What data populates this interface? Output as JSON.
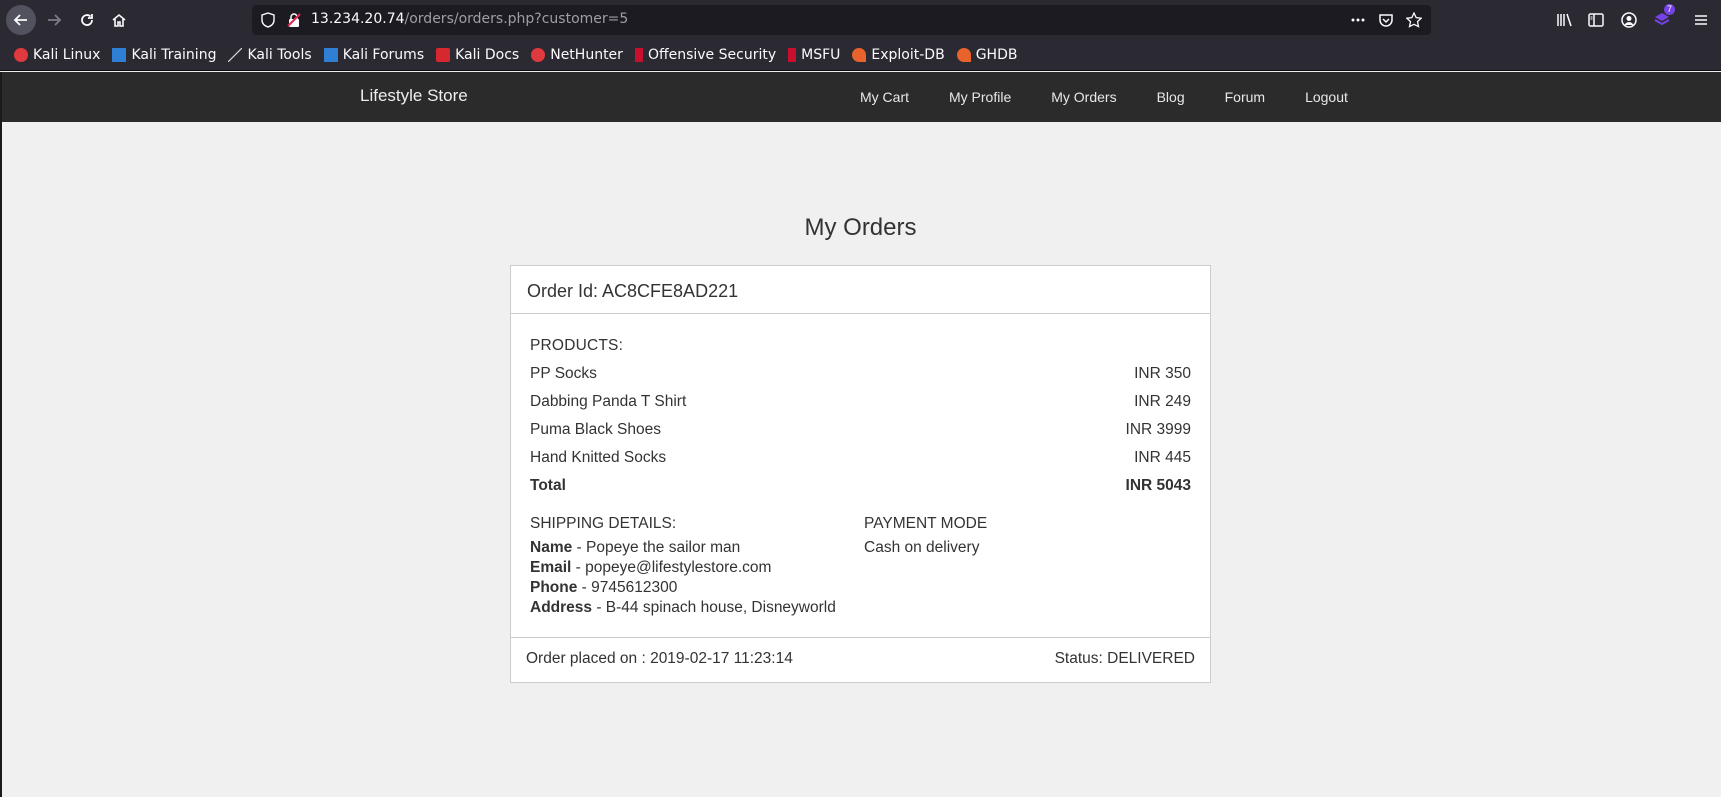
{
  "browser": {
    "url_host": "13.234.20.74",
    "url_path": "/orders/orders.php?customer=5",
    "extension_badge": "7",
    "bookmarks": [
      {
        "label": "Kali Linux",
        "icon": "kali-dragon-icon",
        "color": "#e0393e"
      },
      {
        "label": "Kali Training",
        "icon": "kali-training-icon",
        "color": "#2f7fd4"
      },
      {
        "label": "Kali Tools",
        "icon": "kali-tools-icon",
        "color": "#111111"
      },
      {
        "label": "Kali Forums",
        "icon": "kali-forums-icon",
        "color": "#2f7fd4"
      },
      {
        "label": "Kali Docs",
        "icon": "kali-docs-icon",
        "color": "#d7282f"
      },
      {
        "label": "NetHunter",
        "icon": "nethunter-icon",
        "color": "#e0393e"
      },
      {
        "label": "Offensive Security",
        "icon": "offsec-icon",
        "color": "#c8102e"
      },
      {
        "label": "MSFU",
        "icon": "msfu-icon",
        "color": "#c8102e"
      },
      {
        "label": "Exploit-DB",
        "icon": "exploitdb-icon",
        "color": "#e8632b"
      },
      {
        "label": "GHDB",
        "icon": "ghdb-icon",
        "color": "#e8632b"
      }
    ]
  },
  "site": {
    "brand": "Lifestyle Store",
    "nav": [
      "My Cart",
      "My Profile",
      "My Orders",
      "Blog",
      "Forum",
      "Logout"
    ]
  },
  "page": {
    "title": "My Orders"
  },
  "order": {
    "id_label": "Order Id: AC8CFE8AD221",
    "products_label": "PRODUCTS:",
    "products": [
      {
        "name": "PP Socks",
        "price": "INR 350"
      },
      {
        "name": "Dabbing Panda T Shirt",
        "price": "INR 249"
      },
      {
        "name": "Puma Black Shoes",
        "price": "INR 3999"
      },
      {
        "name": "Hand Knitted Socks",
        "price": "INR 445"
      }
    ],
    "total_label": "Total",
    "total_value": "INR 5043",
    "shipping_label": "SHIPPING DETAILS:",
    "shipping": {
      "name_key": "Name",
      "name_val": " - Popeye the sailor man",
      "email_key": "Email",
      "email_val": " - popeye@lifestylestore.com",
      "phone_key": "Phone",
      "phone_val": " - 9745612300",
      "address_key": "Address",
      "address_val": " - B-44 spinach house, Disneyworld"
    },
    "payment_label": "PAYMENT MODE",
    "payment_value": "Cash on delivery",
    "placed_on": "Order placed on : 2019-02-17 11:23:14",
    "status": "Status: DELIVERED"
  }
}
